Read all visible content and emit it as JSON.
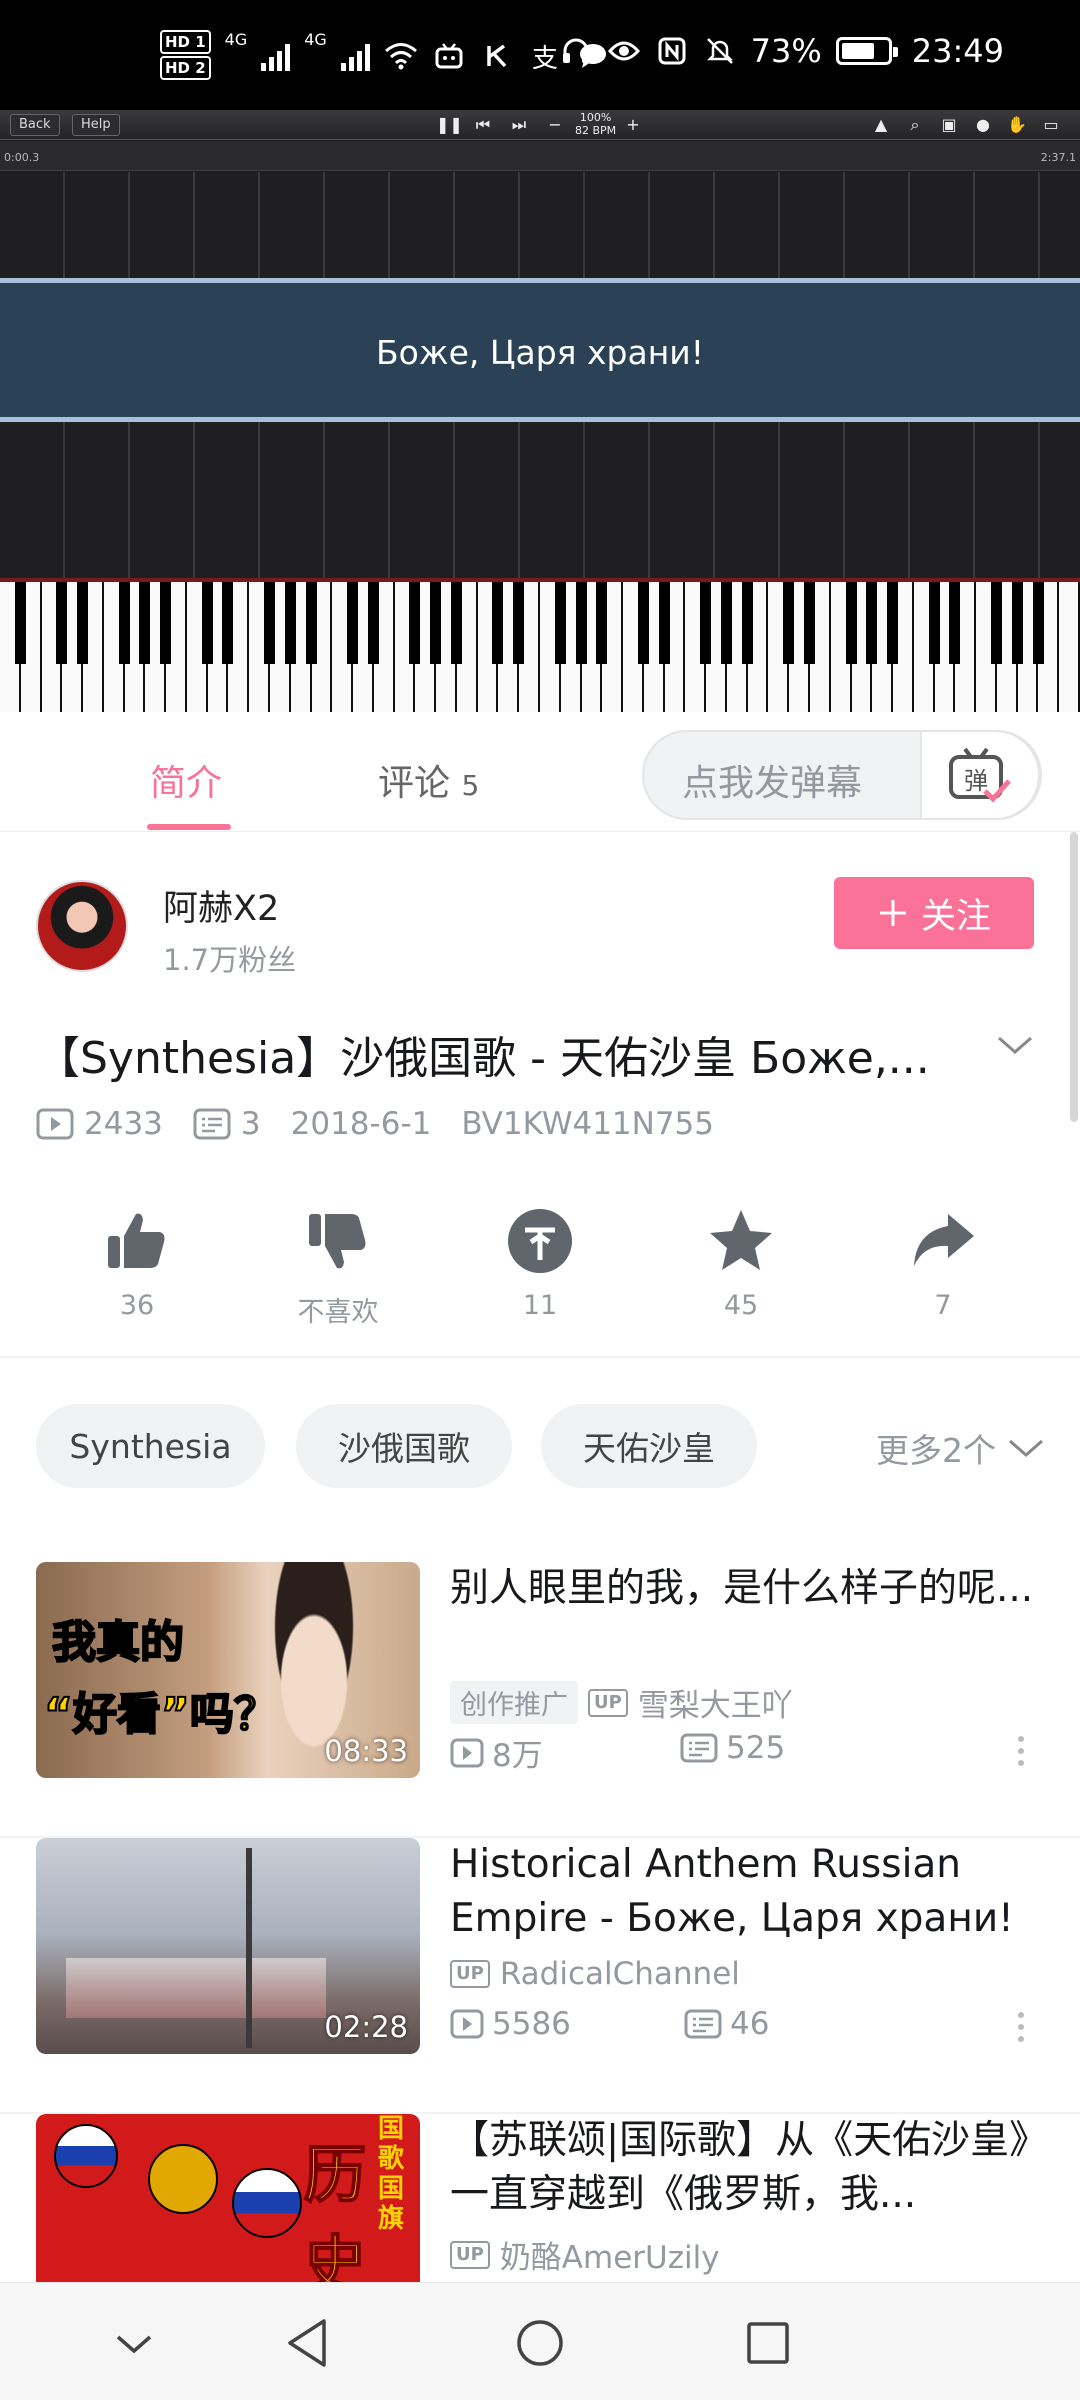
{
  "status_bar": {
    "hd1": "HD 1",
    "hd2": "HD 2",
    "net1": "4G",
    "net2": "4G",
    "battery_pct": "73%",
    "battery_level": 0.73,
    "time": "23:49"
  },
  "player": {
    "back": "Back",
    "help": "Help",
    "zoom_pct": "100%",
    "bpm": "82 BPM",
    "time_start": "0:00.3",
    "time_end": "2:37.1",
    "lyric": "Боже, Царя храни!"
  },
  "tabs": {
    "intro": "简介",
    "comments": "评论",
    "comments_count": "5",
    "danmaku_placeholder": "点我发弹幕"
  },
  "author": {
    "name": "阿赫X2",
    "fans": "1.7万粉丝",
    "follow": "关注"
  },
  "video": {
    "title": "【Synthesia】沙俄国歌 - 天佑沙皇 Боже,...",
    "views": "2433",
    "danmaku": "3",
    "date": "2018-6-1",
    "bvid": "BV1KW411N755"
  },
  "actions": {
    "like": "36",
    "dislike": "不喜欢",
    "coin": "11",
    "fav": "45",
    "share": "7"
  },
  "tags": {
    "items": [
      "Synthesia",
      "沙俄国歌",
      "天佑沙皇"
    ],
    "more": "更多2个"
  },
  "recommendations": [
    {
      "title": "别人眼里的我，是什么样子的呢...",
      "thumb_text_1": "我真的",
      "thumb_text_2": "“好看”吗？",
      "duration": "08:33",
      "badge": "创作推广",
      "up": "雪梨大王吖",
      "views": "8万",
      "danmaku": "525"
    },
    {
      "title": "Historical Anthem Russian Empire - Боже, Царя храни!（...",
      "duration": "02:28",
      "up": "RadicalChannel",
      "views": "5586",
      "danmaku": "46"
    },
    {
      "title": "【苏联颂|国际歌】从《天佑沙皇》一直穿越到《俄罗斯，我...",
      "thumb_text_1": "历史",
      "thumb_text_2": "国歌国旗",
      "up": "奶酪AmerUzily"
    }
  ],
  "labels": {
    "up": "UP"
  },
  "colors": {
    "accent": "#fb7299",
    "muted": "#9499a0"
  }
}
